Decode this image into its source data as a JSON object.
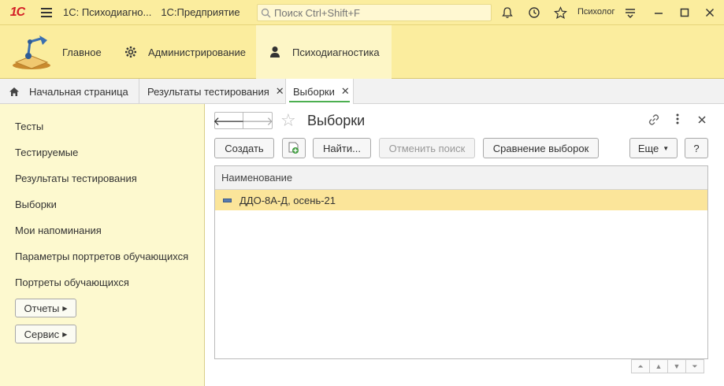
{
  "titlebar": {
    "logo": "1С",
    "app_title": "1С: Психодиагно...",
    "app_sub": "1С:Предприятие",
    "search_placeholder": "Поиск Ctrl+Shift+F",
    "user": "Психолог"
  },
  "sections": [
    {
      "label": "Главное",
      "icon": "desk-lamp-icon"
    },
    {
      "label": "Администрирование",
      "icon": "gear-icon"
    },
    {
      "label": "Психодиагностика",
      "icon": "person-icon",
      "active": true
    }
  ],
  "tabs": [
    {
      "label": "Начальная страница",
      "icon": "home-icon"
    },
    {
      "label": "Результаты тестирования",
      "closable": true
    },
    {
      "label": "Выборки",
      "closable": true,
      "active": true
    }
  ],
  "leftnav": {
    "items": [
      "Тесты",
      "Тестируемые",
      "Результаты тестирования",
      "Выборки",
      "Мои напоминания",
      "Параметры портретов обучающихся",
      "Портреты обучающихся"
    ],
    "buttons": [
      "Отчеты",
      "Сервис"
    ]
  },
  "form": {
    "title": "Выборки",
    "buttons": {
      "create": "Создать",
      "find": "Найти...",
      "cancel_search": "Отменить поиск",
      "compare": "Сравнение выборок",
      "more": "Еще",
      "help": "?"
    },
    "table": {
      "header": "Наименование",
      "rows": [
        "ДДО-8А-Д, осень-21"
      ]
    }
  },
  "colors": {
    "accent_yellow": "#fbed9e",
    "selection": "#fbe59a",
    "tab_underline": "#4caf50",
    "logo_red": "#d41f26"
  }
}
